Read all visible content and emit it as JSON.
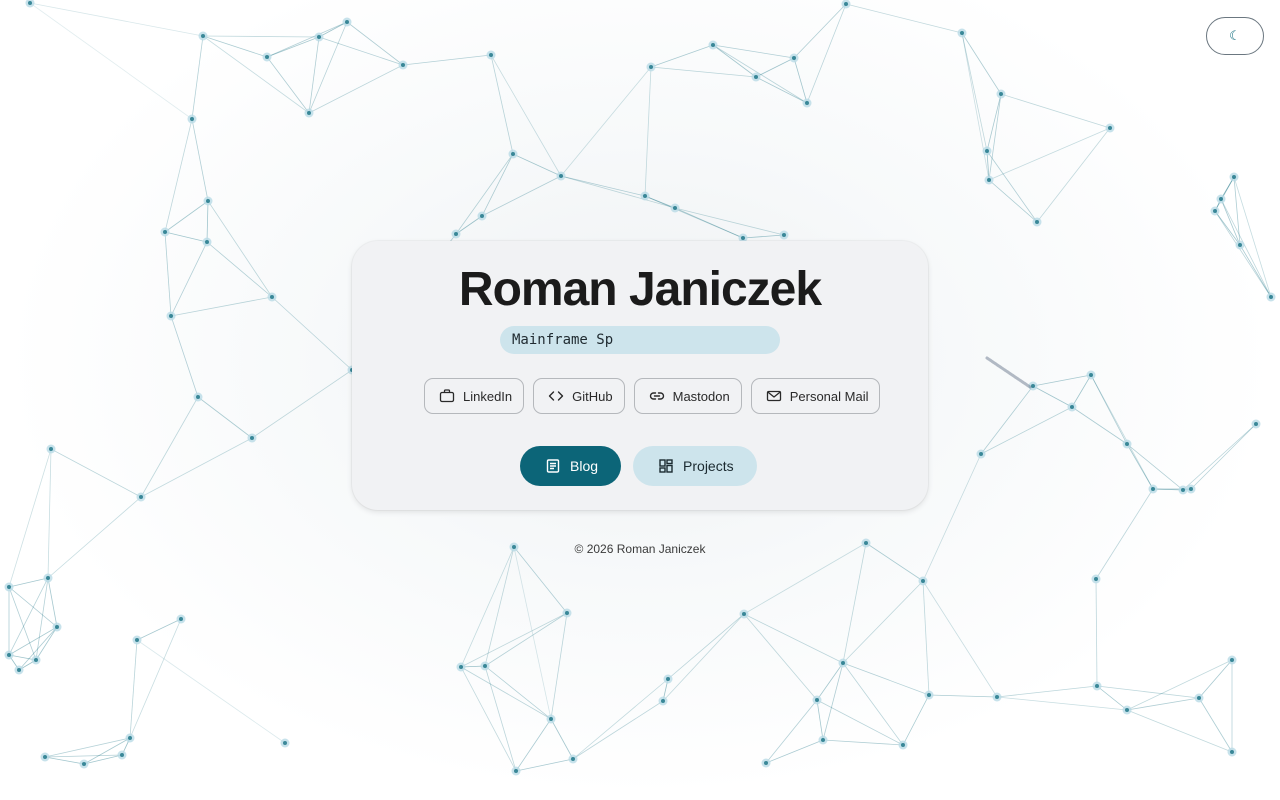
{
  "theme_toggle": {
    "icon": "moon-icon",
    "glyph": "☾"
  },
  "profile": {
    "name": "Roman Janiczek",
    "role": "Mainframe Sp"
  },
  "socials": [
    {
      "label": "LinkedIn",
      "icon": "briefcase-icon"
    },
    {
      "label": "GitHub",
      "icon": "code-icon"
    },
    {
      "label": "Mastodon",
      "icon": "link-icon"
    },
    {
      "label": "Personal Mail",
      "icon": "mail-icon"
    }
  ],
  "nav": [
    {
      "label": "Blog",
      "icon": "document-icon"
    },
    {
      "label": "Projects",
      "icon": "dashboard-icon"
    }
  ],
  "footer": {
    "copyright": "© 2026 Roman Janiczek"
  },
  "colors": {
    "accent": "#0c6578",
    "accent_soft": "#cde4ec",
    "node": "#0e6b7d",
    "node_halo": "#b9dbe6"
  }
}
